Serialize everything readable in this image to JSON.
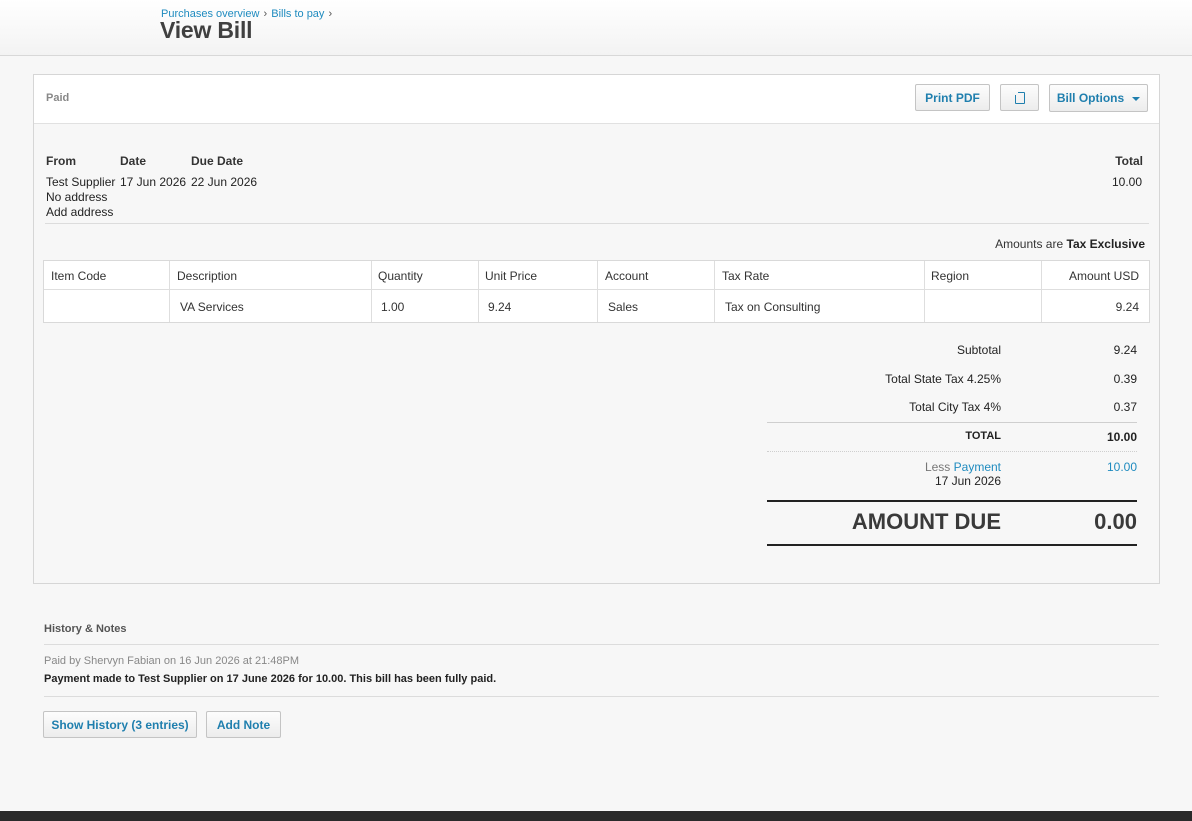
{
  "header": {
    "breadcrumb": [
      "Purchases overview",
      "Bills to pay"
    ],
    "breadcrumb_sep": "›",
    "title": "View Bill"
  },
  "panel": {
    "status": "Paid",
    "buttons": {
      "print": "Print PDF",
      "copy_icon": "copy-icon",
      "options": "Bill Options"
    },
    "details": {
      "from_label": "From",
      "date_label": "Date",
      "due_label": "Due Date",
      "total_label": "Total",
      "supplier": "Test Supplier",
      "date": "17 Jun 2026",
      "due_date": "22 Jun 2026",
      "total": "10.00",
      "no_address": "No address",
      "add_address": "Add address"
    },
    "amounts_are": "Amounts are",
    "tax_mode": "Tax Exclusive",
    "table": {
      "columns": [
        "Item Code",
        "Description",
        "Quantity",
        "Unit Price",
        "Account",
        "Tax Rate",
        "Region",
        "Amount USD"
      ],
      "rows": [
        [
          "",
          "VA Services",
          "1.00",
          "9.24",
          "Sales",
          "Tax on Consulting",
          "",
          "9.24"
        ]
      ]
    },
    "totals": {
      "subtotal_label": "Subtotal",
      "subtotal": "9.24",
      "state_tax_label": "Total State Tax 4.25%",
      "state_tax": "0.39",
      "city_tax_label": "Total City Tax 4%",
      "city_tax": "0.37",
      "total_label": "TOTAL",
      "total": "10.00",
      "less_label": "Less",
      "payment_label": "Payment",
      "payment_date": "17 Jun 2026",
      "payment": "10.00",
      "amount_due_label": "AMOUNT DUE",
      "amount_due": "0.00"
    }
  },
  "history": {
    "title": "History & Notes",
    "meta": "Paid by Shervyn Fabian on 16 Jun 2026 at 21:48PM",
    "text": "Payment made to Test Supplier on 17 June 2026 for 10.00. This bill has been fully paid.",
    "show_history": "Show History (3 entries)",
    "add_note": "Add Note"
  },
  "colors": {
    "link": "#1f8bbf",
    "button_text": "#1f7fae",
    "background": "#f7f7f7"
  }
}
